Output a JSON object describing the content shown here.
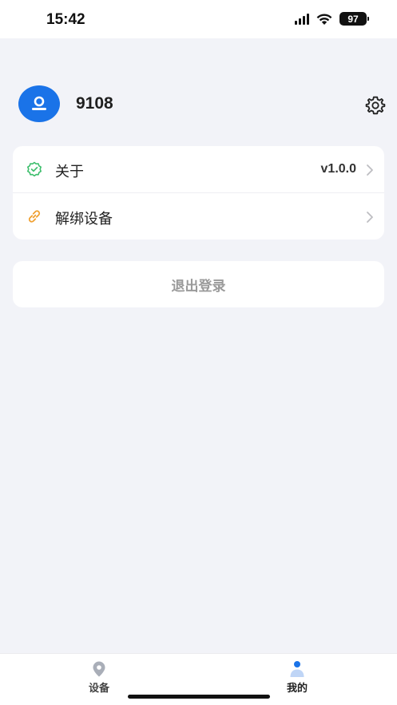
{
  "status_bar": {
    "time": "15:42",
    "battery": "97",
    "icons": [
      "signal-icon",
      "wifi-icon",
      "battery-icon"
    ]
  },
  "profile": {
    "username": "9108",
    "avatar_icon": "user-icon",
    "settings_icon": "gear-icon"
  },
  "menu": {
    "items": [
      {
        "label": "关于",
        "value": "v1.0.0",
        "icon": "badge-check-icon",
        "icon_color": "#3DBE6C"
      },
      {
        "label": "解绑设备",
        "value": "",
        "icon": "link-icon",
        "icon_color": "#F0A030"
      }
    ]
  },
  "logout": {
    "label": "退出登录"
  },
  "tab_bar": {
    "tabs": [
      {
        "label": "设备",
        "icon": "location-pin-icon",
        "active": false
      },
      {
        "label": "我的",
        "icon": "person-icon",
        "active": true
      }
    ]
  },
  "colors": {
    "accent": "#1A73E8",
    "background": "#F2F3F8",
    "card": "#FFFFFF",
    "muted_text": "#9A9A9A"
  }
}
